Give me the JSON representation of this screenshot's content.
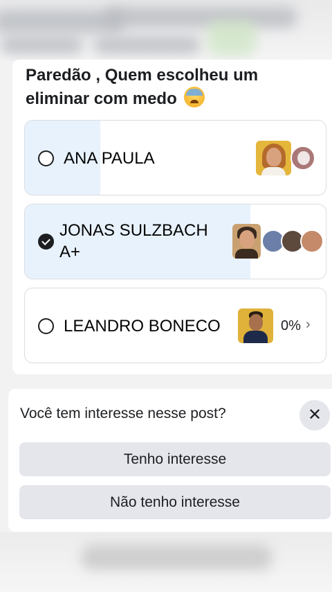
{
  "post": {
    "question": "Paredão , Quem escolheu um eliminar com medo",
    "emoji_icon": "anxious-face-with-sweat-emoji"
  },
  "poll": {
    "options": [
      {
        "label": "ANA PAULA",
        "selected": false,
        "vote_fill_fraction": 0.25
      },
      {
        "label": "JONAS SULZBACH A+",
        "selected": true,
        "vote_fill_fraction": 0.75
      },
      {
        "label": "LEANDRO BONECO",
        "selected": false,
        "vote_fill_fraction": 0.0,
        "percent_text": "0%",
        "chevron": "›"
      }
    ]
  },
  "interest_prompt": {
    "question": "Você tem interesse nesse post?",
    "close_symbol": "✕",
    "yes_label": "Tenho interesse",
    "no_label": "Não tenho interesse"
  },
  "colors": {
    "poll_fill": "#e8f2fc",
    "button_bg": "#e4e6eb",
    "text": "#1c1e21"
  }
}
